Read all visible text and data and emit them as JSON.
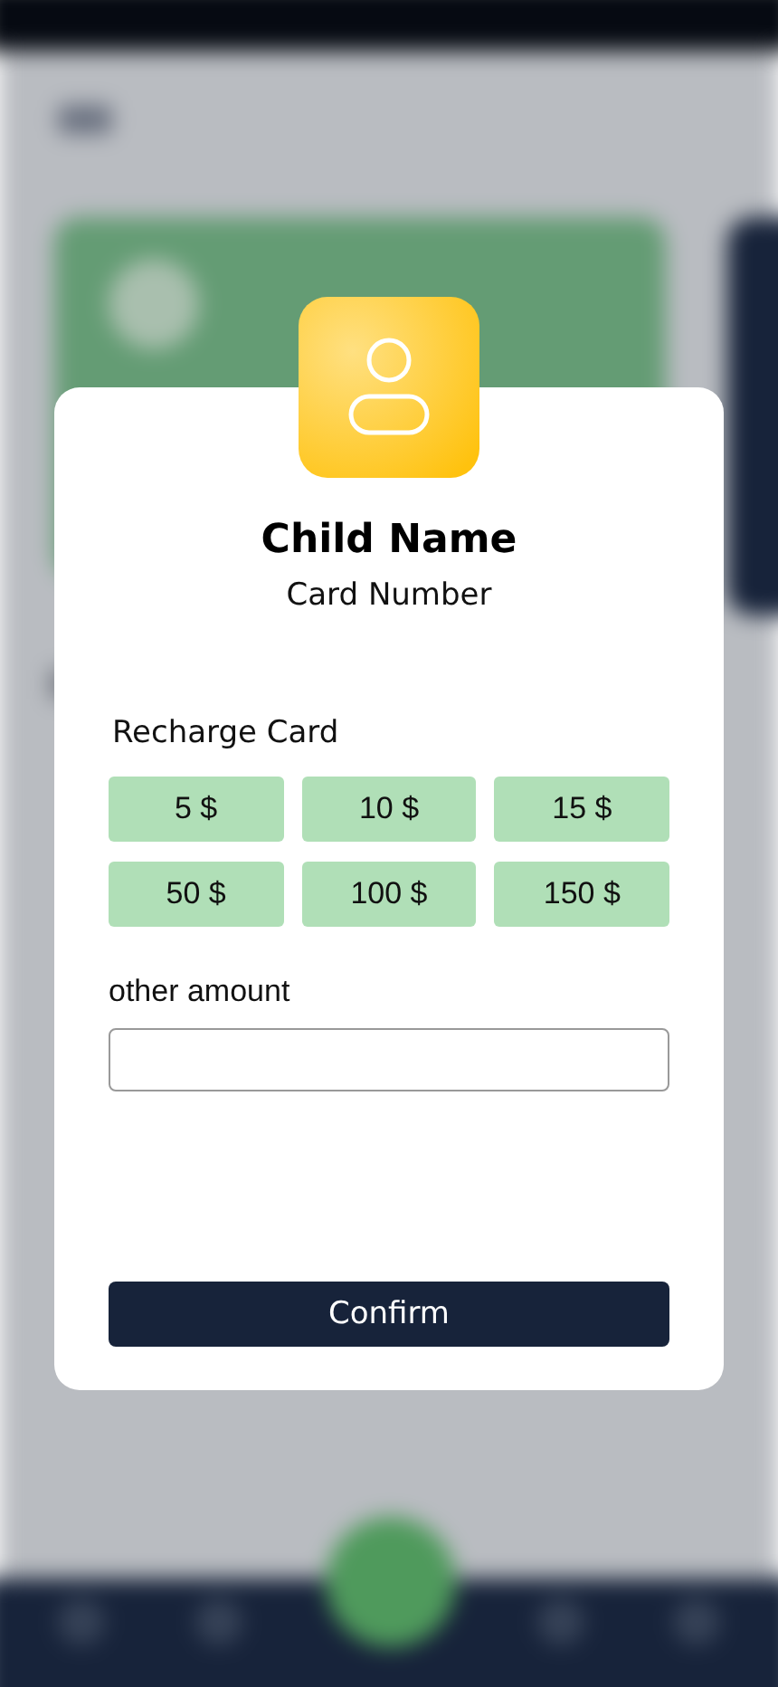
{
  "dialog": {
    "title": "Child Name",
    "subtitle": "Card Number",
    "section_label": "Recharge Card",
    "amounts": [
      "5 $",
      "10 $",
      "15 $",
      "50 $",
      "100 $",
      "150 $"
    ],
    "other_amount": {
      "label": "other amount"
    },
    "confirm_button": "Confirm"
  }
}
